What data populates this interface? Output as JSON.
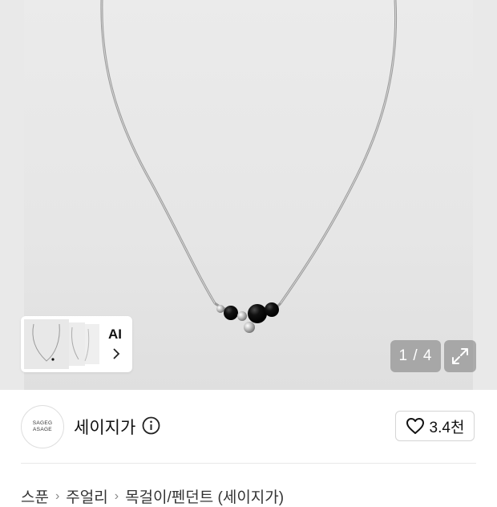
{
  "gallery": {
    "counter": "1 / 4",
    "ai_label": "AI",
    "ai_thumb_icon": "necklace-thumbnail-stack",
    "expand_icon": "expand-icon",
    "chevron_icon": "chevron-right-icon"
  },
  "brand": {
    "logo_text_line1": "SAGEG",
    "logo_text_line2": "ASAGE",
    "name": "세이지가",
    "info_icon": "info-icon"
  },
  "like": {
    "icon": "heart-icon",
    "count": "3.4천"
  },
  "breadcrumb": {
    "items": [
      "스푼",
      "주얼리",
      "목걸이/펜던트 (세이지가)"
    ]
  }
}
